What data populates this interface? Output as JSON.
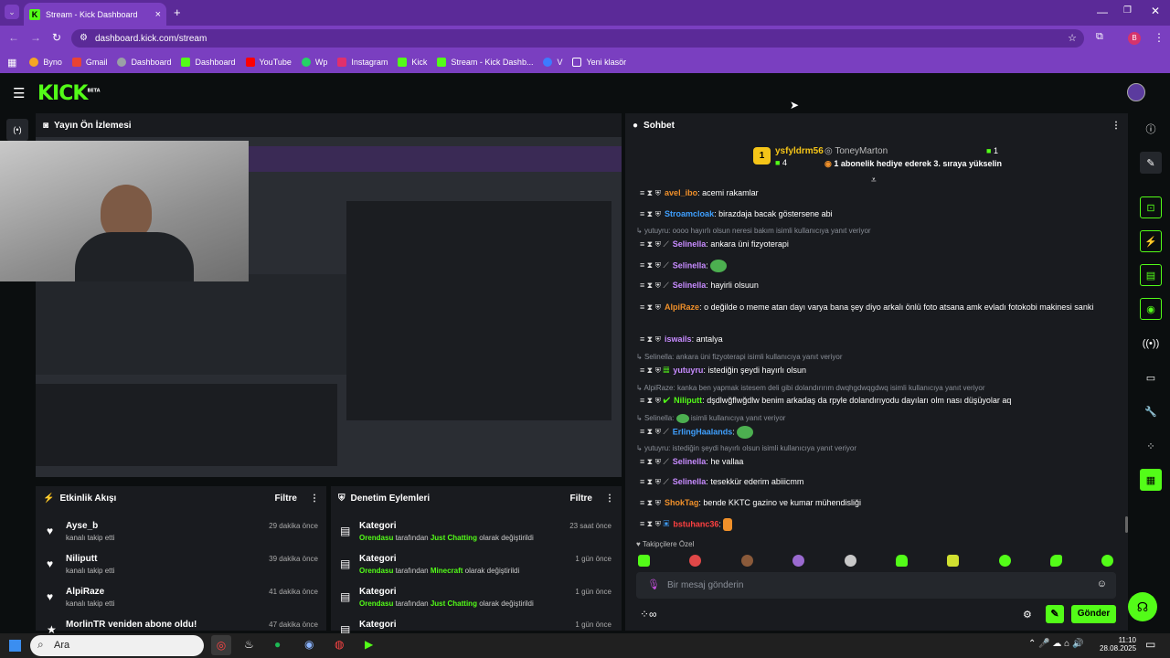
{
  "browser": {
    "tab_title": "Stream - Kick Dashboard",
    "url": "dashboard.kick.com/stream",
    "profile_initial": "B",
    "bookmarks": [
      "Byno",
      "Gmail",
      "Dashboard",
      "Dashboard",
      "YouTube",
      "Wp",
      "Instagram",
      "Kick",
      "Stream - Kick Dashb...",
      "V",
      "Yeni klasör"
    ]
  },
  "header": {
    "logo": "KICK",
    "beta": "BETA"
  },
  "preview": {
    "title": "Yayın Ön İzlemesi"
  },
  "activity": {
    "title": "Etkinlik Akışı",
    "filter": "Filtre",
    "items": [
      {
        "name": "Ayse_b",
        "sub": "kanalı takip etti",
        "time": "29 dakika önce"
      },
      {
        "name": "Niliputt",
        "sub": "kanalı takip etti",
        "time": "39 dakika önce"
      },
      {
        "name": "AlpiRaze",
        "sub": "kanalı takip etti",
        "time": "41 dakika önce"
      },
      {
        "name": "MorlinTR veniden abone oldu!",
        "sub": "",
        "time": "47 dakika önce"
      }
    ]
  },
  "moderation": {
    "title": "Denetim Eylemleri",
    "filter": "Filtre",
    "items": [
      {
        "name": "Kategori",
        "by": "Orendasu",
        "mid": "tarafından",
        "cat": "Just Chatting",
        "end": "olarak değiştirildi",
        "time": "23 saat önce"
      },
      {
        "name": "Kategori",
        "by": "Orendasu",
        "mid": "tarafından",
        "cat": "Minecraft",
        "end": "olarak değiştirildi",
        "time": "1 gün önce"
      },
      {
        "name": "Kategori",
        "by": "Orendasu",
        "mid": "tarafından",
        "cat": "Just Chatting",
        "end": "olarak değiştirildi",
        "time": "1 gün önce"
      },
      {
        "name": "Kategori",
        "time": "1 gün önce"
      }
    ]
  },
  "chat": {
    "title": "Sohbet",
    "top_gifter": {
      "rank": "1",
      "name": "ysfyldrm56",
      "count": "4"
    },
    "gift_user": "ToneyMarton",
    "gift_count": "1",
    "gift_text": "1 abonelik hediye ederek 3. sıraya yükselin",
    "messages": [
      {
        "user": "avel_ibo",
        "text": "acemi rakamlar",
        "color": "#f0902a"
      },
      {
        "user": "Stroamcloak",
        "text": "birazdaja bacak göstersene abi",
        "color": "#3fa0ff"
      },
      {
        "reply": "yutuyru: oooo hayırlı olsun neresi bakım isimli kullanıcıya yanıt veriyor"
      },
      {
        "user": "Selinella",
        "text": "ankara üni fizyoterapi",
        "color": "#c78bff"
      },
      {
        "user": "Selinella",
        "text": "",
        "color": "#c78bff"
      },
      {
        "user": "Selinella",
        "text": "hayirli olsuun",
        "color": "#c78bff"
      },
      {
        "user": "AlpiRaze",
        "text": "o değilde o meme atan dayı varya bana şey diyo arkalı önlü foto atsana amk evladı fotokobi makinesi sanki",
        "color": "#f0902a"
      },
      {
        "user": "iswails",
        "text": "antalya",
        "color": "#c78bff"
      },
      {
        "reply": "Selinella: ankara üni fizyoterapi isimli kullanıcıya yanıt veriyor"
      },
      {
        "user": "yutuyru",
        "text": "istediğin şeydi hayırlı olsun",
        "color": "#c78bff"
      },
      {
        "reply": "AlpiRaze: kanka ben yapmak istesem deli gibi dolandırırım dwqhgdwqgdwq isimli kullanıcıya yanıt veriyor"
      },
      {
        "user": "Niliputt",
        "text": "dşdlwğflwğdlw benim arkadaş da rpyle dolandırıyodu dayıları olm nası düşüyolar aq",
        "color": "#53fc18"
      },
      {
        "reply": "Selinella:",
        "reply2": "isimli kullanıcıya yanıt veriyor"
      },
      {
        "user": "ErlingHaalands",
        "text": "",
        "color": "#3fa0ff"
      },
      {
        "reply": "yutuyru: istediğin şeydi hayırlı olsun isimli kullanıcıya yanıt veriyor"
      },
      {
        "user": "Selinella",
        "text": "he vallaa",
        "color": "#c78bff"
      },
      {
        "user": "Selinella",
        "text": "tesekkür ederim abiiicmm",
        "color": "#c78bff"
      },
      {
        "user": "ShokTag",
        "text": "bende KKTC gazino ve kumar mühendisliği",
        "color": "#f0902a"
      },
      {
        "user": "bstuhanc36",
        "text": "",
        "color": "#ff4040"
      }
    ],
    "emote_label": "Takipçilere Özel",
    "input_placeholder": "Bir mesaj gönderin",
    "send": "Gönder"
  },
  "taskbar": {
    "search": "Ara",
    "time": "11:10",
    "date": "28.08.2025"
  }
}
